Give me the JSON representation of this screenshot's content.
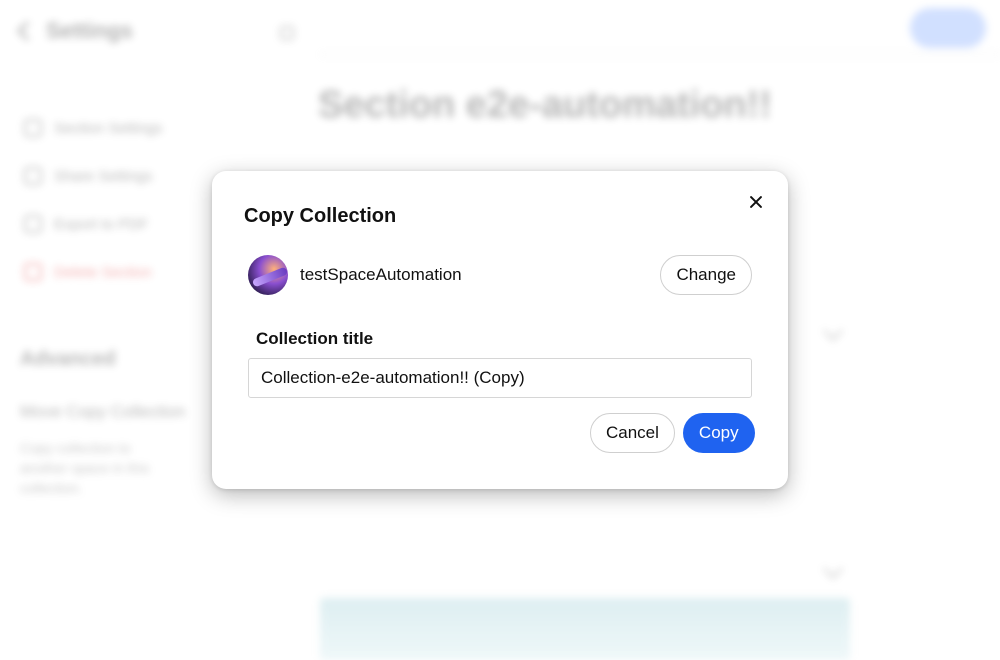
{
  "background": {
    "header_title": "Settings",
    "main_title": "Section e2e-automation!!",
    "nav_items": [
      {
        "label": "Section Settings",
        "icon": "settings-icon"
      },
      {
        "label": "Share Settings",
        "icon": "share-icon"
      },
      {
        "label": "Export to PDF",
        "icon": "pdf-icon"
      },
      {
        "label": "Delete Section",
        "icon": "trash-icon"
      }
    ],
    "section_title": "Advanced",
    "subtitle": "Move Copy Collection",
    "description": "Copy collection to another space in this collection."
  },
  "dialog": {
    "title": "Copy Collection",
    "space_name": "testSpaceAutomation",
    "change_label": "Change",
    "field_label": "Collection title",
    "field_value": "Collection-e2e-automation!! (Copy)",
    "cancel_label": "Cancel",
    "copy_label": "Copy"
  },
  "colors": {
    "primary": "#1f63f0",
    "danger": "#e02020"
  }
}
